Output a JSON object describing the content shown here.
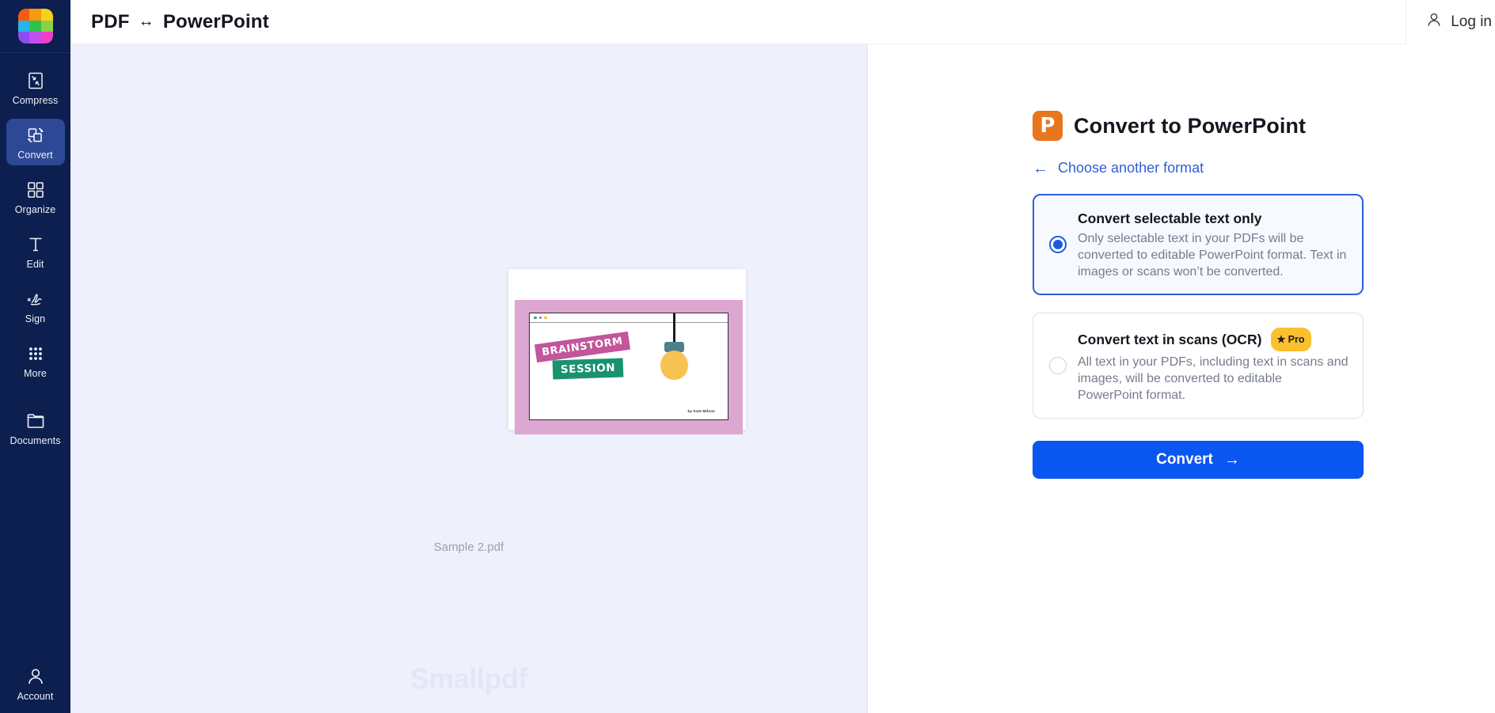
{
  "app": {
    "logo_colors": [
      "#f25c10",
      "#f79a10",
      "#f5d117",
      "#2bb3e8",
      "#2fc04d",
      "#8bd045",
      "#8a4ff0",
      "#c44ef0",
      "#ef3fc6"
    ],
    "logo_name": "smallpdf-logo"
  },
  "header": {
    "title_left": "PDF",
    "title_swap": "↔",
    "title_right": "PowerPoint",
    "login_label": "Log in"
  },
  "sidebar": {
    "items": [
      {
        "label": "Compress",
        "icon": "compress-icon",
        "active": false
      },
      {
        "label": "Convert",
        "icon": "convert-icon",
        "active": true
      },
      {
        "label": "Organize",
        "icon": "organize-icon",
        "active": false
      },
      {
        "label": "Edit",
        "icon": "edit-text-icon",
        "active": false
      },
      {
        "label": "Sign",
        "icon": "signature-icon",
        "active": false
      },
      {
        "label": "More",
        "icon": "grid-dots-icon",
        "active": false
      },
      {
        "label": "Documents",
        "icon": "folder-icon",
        "active": false
      }
    ],
    "account_label": "Account",
    "account_icon": "user-icon"
  },
  "canvas": {
    "filename": "Sample 2.pdf",
    "watermark": "Smallpdf",
    "thumbnail": {
      "name": "pdf-page-thumbnail",
      "heading_primary": "BRAINSTORM",
      "heading_secondary": "SESSION",
      "byline": "by Kate Milson",
      "frame_color": "#dca7d0",
      "primary_tag_color": "#c2559b",
      "secondary_tag_color": "#18926f",
      "bulb_color": "#f6c353"
    }
  },
  "panel": {
    "title": "Convert to PowerPoint",
    "badge_letter": "P",
    "badge_color": "#e8761f",
    "back_link": "Choose another format",
    "back_arrow": "←",
    "options": [
      {
        "title": "Convert selectable text only",
        "desc": "Only selectable text in your PDFs will be converted to editable PowerPoint format. Text in images or scans won’t be converted.",
        "selected": true,
        "badge": null
      },
      {
        "title": "Convert text in scans (OCR)",
        "desc": "All text in your PDFs, including text in scans and images, will be converted to editable PowerPoint format.",
        "selected": false,
        "badge": "Pro",
        "badge_star": "★"
      }
    ],
    "convert_button": "Convert",
    "convert_arrow": "→",
    "accent_color": "#0a56f0"
  }
}
